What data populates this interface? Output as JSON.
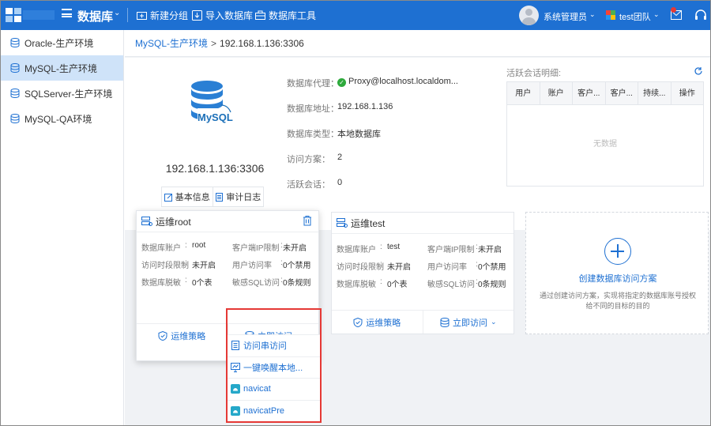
{
  "topbar": {
    "app_title": "数据库",
    "buttons": [
      {
        "label": "新建分组",
        "icon": "folder-plus-icon"
      },
      {
        "label": "导入数据库",
        "icon": "import-icon"
      },
      {
        "label": "数据库工具",
        "icon": "toolbox-icon"
      }
    ],
    "user_name": "系统管理员",
    "team_name": "test团队"
  },
  "sidebar": {
    "items": [
      {
        "label": "Oracle-生产环境"
      },
      {
        "label": "MySQL-生产环境"
      },
      {
        "label": "SQLServer-生产环境"
      },
      {
        "label": "MySQL-QA环境"
      }
    ],
    "active_index": 1
  },
  "breadcrumb": {
    "parent": "MySQL-生产环境",
    "separator": ">",
    "current": "192.168.1.136:3306"
  },
  "db_info": {
    "logo_text": "MySQL",
    "host_title": "192.168.1.136:3306",
    "basic_info_label": "基本信息",
    "audit_log_label": "审计日志",
    "props": [
      {
        "label": "数据库代理",
        "value": "Proxy@localhost.localdom..."
      },
      {
        "label": "数据库地址",
        "value": "192.168.1.136"
      },
      {
        "label": "数据库类型",
        "value": "本地数据库"
      },
      {
        "label": "访问方案",
        "value": "2"
      },
      {
        "label": "活跃会话",
        "value": "0"
      }
    ],
    "prop_colon": "：",
    "proxy_status_icon": "✓"
  },
  "sessions": {
    "title": "活跃会话明细:",
    "columns": [
      "用户",
      "账户",
      "客户...",
      "客户...",
      "持续...",
      "操作"
    ],
    "empty_text": "无数据"
  },
  "cards": [
    {
      "title": "运维root",
      "fields": [
        {
          "label": "数据库账户",
          "value": "root"
        },
        {
          "label": "客户端IP限制",
          "value": "未开启"
        },
        {
          "label": "访问时段限制",
          "value": "未开启"
        },
        {
          "label": "用户访问率",
          "value": "0个禁用"
        },
        {
          "label": "数据库脱敏",
          "value": "0个表"
        },
        {
          "label": "敏感SQL访问",
          "value": "0条规则"
        }
      ],
      "policy_label": "运维策略",
      "access_label": "立即访问"
    },
    {
      "title": "运维test",
      "fields": [
        {
          "label": "数据库账户",
          "value": "test"
        },
        {
          "label": "客户端IP限制",
          "value": "未开启"
        },
        {
          "label": "访问时段限制",
          "value": "未开启"
        },
        {
          "label": "用户访问率",
          "value": "0个禁用"
        },
        {
          "label": "数据库脱敏",
          "value": "0个表"
        },
        {
          "label": "敏感SQL访问",
          "value": "0条规则"
        }
      ],
      "policy_label": "运维策略",
      "access_label": "立即访问"
    }
  ],
  "field_colon": ":",
  "create_card": {
    "label": "创建数据库访问方案",
    "description": "通过创建访问方案，实现将指定的数据库账号授权给不同的目标的目的"
  },
  "access_dropdown": {
    "items": [
      {
        "label": "访问串访问",
        "icon": "document-icon"
      },
      {
        "label": "一键唤醒本地...",
        "icon": "desktop-icon"
      },
      {
        "label": "navicat",
        "icon": "navicat-icon"
      },
      {
        "label": "navicatPre",
        "icon": "navicat-icon"
      }
    ]
  },
  "colors": {
    "primary": "#1e70d2",
    "sidebar_active": "#cfe3f9",
    "status_ok": "#2eaa3c",
    "highlight_border": "#e53935"
  }
}
